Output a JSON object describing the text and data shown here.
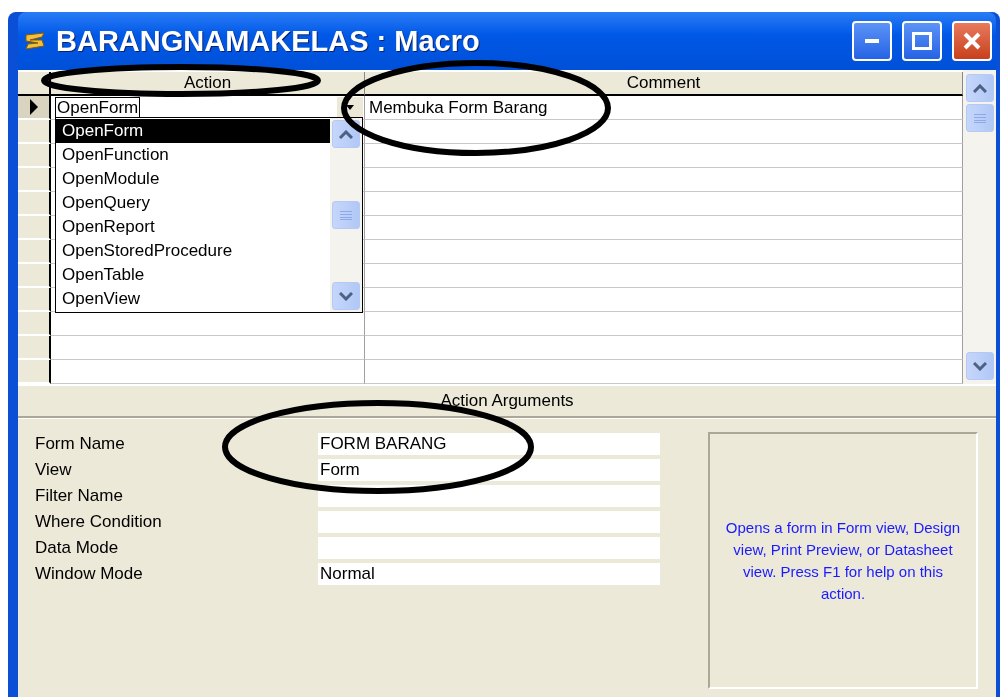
{
  "window": {
    "title": "BARANGNAMAKELAS : Macro"
  },
  "grid": {
    "columns": [
      {
        "label": "Action",
        "circled": true
      },
      {
        "label": "Comment",
        "circled": true
      }
    ],
    "rows": [
      {
        "current": true,
        "action": "OpenForm",
        "comment": "Membuka Form Barang"
      },
      {
        "current": false
      },
      {
        "current": false
      },
      {
        "current": false
      },
      {
        "current": false
      },
      {
        "current": false
      },
      {
        "current": false
      },
      {
        "current": false
      },
      {
        "current": false
      },
      {
        "current": false
      },
      {
        "current": false
      },
      {
        "current": false
      }
    ]
  },
  "action_dropdown": {
    "items": [
      {
        "label": "OpenForm",
        "selected": true
      },
      {
        "label": "OpenFunction",
        "selected": false
      },
      {
        "label": "OpenModule",
        "selected": false
      },
      {
        "label": "OpenQuery",
        "selected": false
      },
      {
        "label": "OpenReport",
        "selected": false
      },
      {
        "label": "OpenStoredProcedure",
        "selected": false
      },
      {
        "label": "OpenTable",
        "selected": false
      },
      {
        "label": "OpenView",
        "selected": false
      }
    ]
  },
  "arguments": {
    "title": "Action Arguments",
    "fields": [
      {
        "label": "Form Name",
        "value": "FORM BARANG",
        "circled": true
      },
      {
        "label": "View",
        "value": "Form"
      },
      {
        "label": "Filter Name"
      },
      {
        "label": "Where Condition"
      },
      {
        "label": "Data Mode"
      },
      {
        "label": "Window Mode",
        "value": "Normal"
      }
    ],
    "help_text": "Opens a form in Form view, Design view, Print Preview, or Datasheet view. Press F1 for help on this action."
  }
}
